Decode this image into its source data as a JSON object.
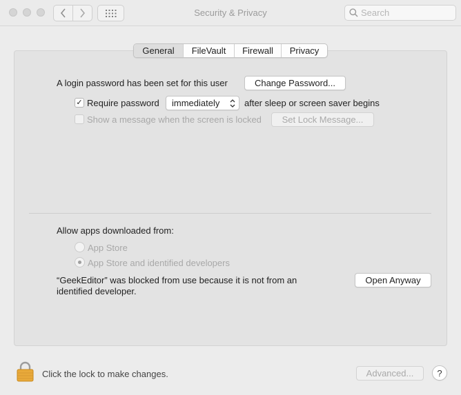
{
  "window": {
    "title": "Security & Privacy"
  },
  "toolbar": {
    "back_icon": "chevron-left-icon",
    "forward_icon": "chevron-right-icon",
    "grid_icon": "show-all-grid-icon",
    "search_placeholder": "Search"
  },
  "tabs": [
    {
      "label": "General",
      "selected": true
    },
    {
      "label": "FileVault",
      "selected": false
    },
    {
      "label": "Firewall",
      "selected": false
    },
    {
      "label": "Privacy",
      "selected": false
    }
  ],
  "general": {
    "login_password_text": "A login password has been set for this user",
    "change_password_label": "Change Password...",
    "require_password": {
      "checked": true,
      "check_glyph": "✓",
      "label": "Require password",
      "popup_value": "immediately",
      "suffix": "after sleep or screen saver begins"
    },
    "show_message": {
      "checked": false,
      "label": "Show a message when the screen is locked",
      "button_label": "Set Lock Message..."
    }
  },
  "apps": {
    "heading": "Allow apps downloaded from:",
    "options": [
      {
        "label": "App Store",
        "selected": false
      },
      {
        "label": "App Store and identified developers",
        "selected": true
      }
    ],
    "blocked_line1": "“GeekEditor” was blocked from use because it is not from an",
    "blocked_line2": "identified developer.",
    "open_anyway_label": "Open Anyway"
  },
  "footer": {
    "lock_text": "Click the lock to make changes.",
    "advanced_label": "Advanced...",
    "help_label": "?"
  },
  "colors": {
    "window_bg": "#ececec",
    "panel_bg": "#e3e3e3",
    "lock_gold": "#e8a93a",
    "disabled_text": "#a8a8a8"
  }
}
